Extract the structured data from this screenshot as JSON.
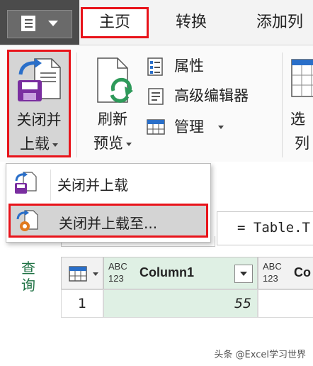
{
  "tabs": {
    "home": "主页",
    "transform": "转换",
    "add_column": "添加列"
  },
  "ribbon": {
    "close_load_line1": "关闭并",
    "close_load_line2": "上载",
    "refresh_line1": "刷新",
    "refresh_line2": "预览",
    "properties": "属性",
    "advanced_editor": "高级编辑器",
    "manage": "管理",
    "choose_line1": "选",
    "choose_line2": "列"
  },
  "dropdown": {
    "item1": "关闭并上载",
    "item2": "关闭并上载至..."
  },
  "formula": "= Table.T",
  "side": {
    "queries": "查询"
  },
  "grid": {
    "type_tag_line1": "ABC",
    "type_tag_line2": "123",
    "col1": "Column1",
    "col2": "Co",
    "row1_num": "1",
    "row1_val": "55"
  },
  "watermark": "头条 @Excel学习世界",
  "colors": {
    "highlight_border": "#e8131a",
    "accent_green": "#217346",
    "selected_col": "#dff0e4"
  }
}
